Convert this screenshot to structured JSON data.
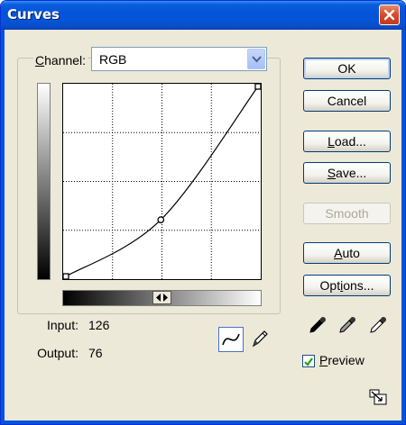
{
  "window": {
    "title": "Curves"
  },
  "channel": {
    "label_mnemonic": "C",
    "label_rest": "hannel:",
    "value": "RGB"
  },
  "info": {
    "input_label": "Input:",
    "input_value": "126",
    "output_label": "Output:",
    "output_value": "76"
  },
  "buttons": {
    "ok": "OK",
    "cancel": "Cancel",
    "load_m": "L",
    "load_rest": "oad...",
    "save_m": "S",
    "save_rest": "ave...",
    "smooth": "Smooth",
    "auto_m": "A",
    "auto_rest": "uto",
    "options_pre": "Opt",
    "options_m": "i",
    "options_rest": "ons..."
  },
  "preview": {
    "m": "P",
    "rest": "review",
    "checked": true
  },
  "curve": {
    "points": [
      [
        0,
        0
      ],
      [
        126,
        76
      ],
      [
        255,
        255
      ]
    ],
    "grid_divisions": 4
  },
  "icons": {
    "close": "close-icon",
    "dropdown": "chevron-down-icon",
    "curve_tool": "curve-tool-icon",
    "pencil_tool": "pencil-icon",
    "black_eyedropper": "eyedropper-black-icon",
    "gray_eyedropper": "eyedropper-gray-icon",
    "white_eyedropper": "eyedropper-white-icon",
    "gradient_toggle": "gradient-toggle-icon",
    "expand": "expand-icon"
  },
  "colors": {
    "title_bar": "#0553da",
    "close_button": "#d8492a",
    "dialog_bg": "#ece9d8"
  }
}
